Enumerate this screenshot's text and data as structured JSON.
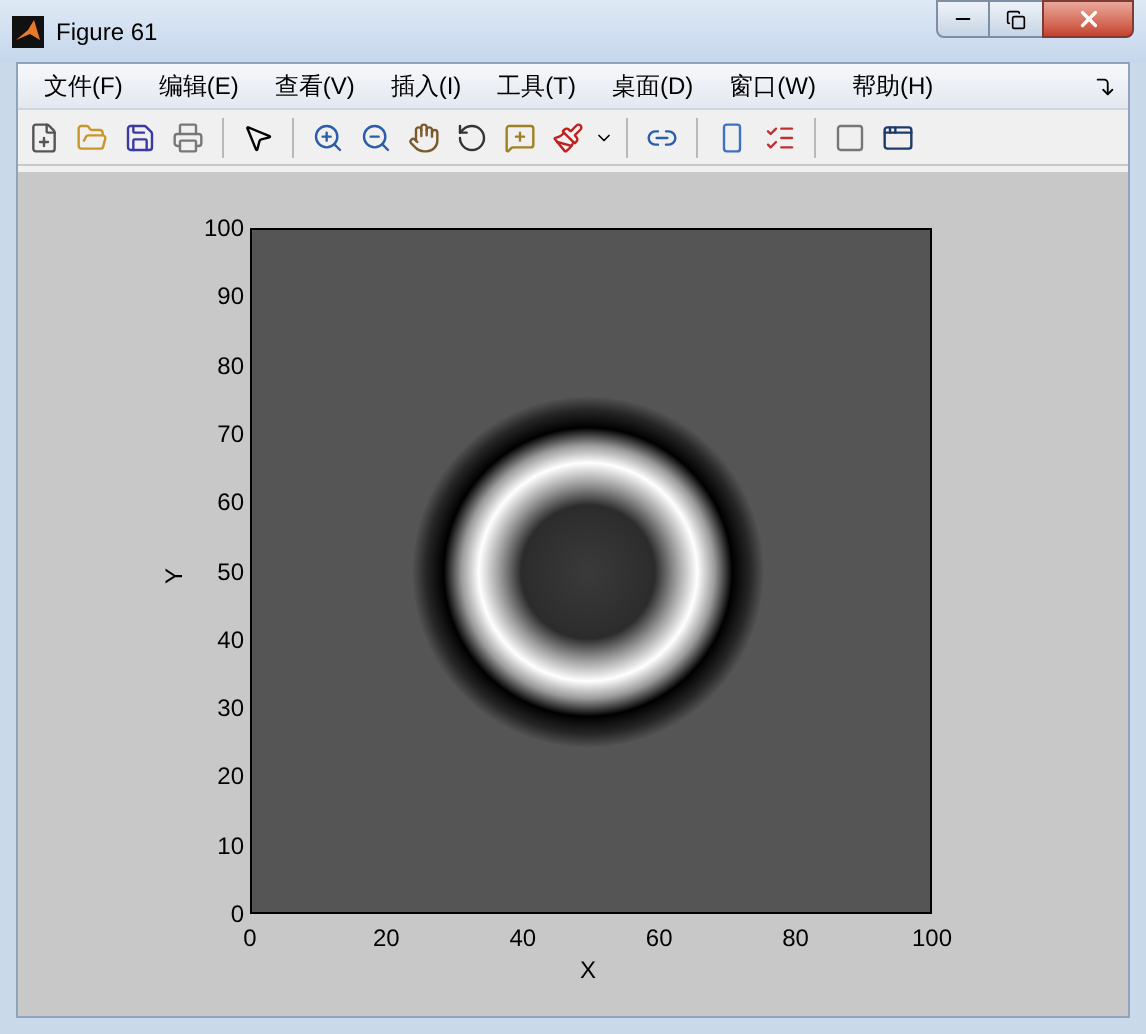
{
  "window": {
    "title": "Figure 61"
  },
  "menu": [
    {
      "label": "文件(F)"
    },
    {
      "label": "编辑(E)"
    },
    {
      "label": "查看(V)"
    },
    {
      "label": "插入(I)"
    },
    {
      "label": "工具(T)"
    },
    {
      "label": "桌面(D)"
    },
    {
      "label": "窗口(W)"
    },
    {
      "label": "帮助(H)"
    }
  ],
  "axes": {
    "xlabel": "X",
    "ylabel": "Y",
    "xticks": [
      "0",
      "20",
      "40",
      "60",
      "80",
      "100"
    ],
    "yticks": [
      "100",
      "90",
      "80",
      "70",
      "60",
      "50",
      "40",
      "30",
      "20",
      "10",
      "0"
    ]
  }
}
